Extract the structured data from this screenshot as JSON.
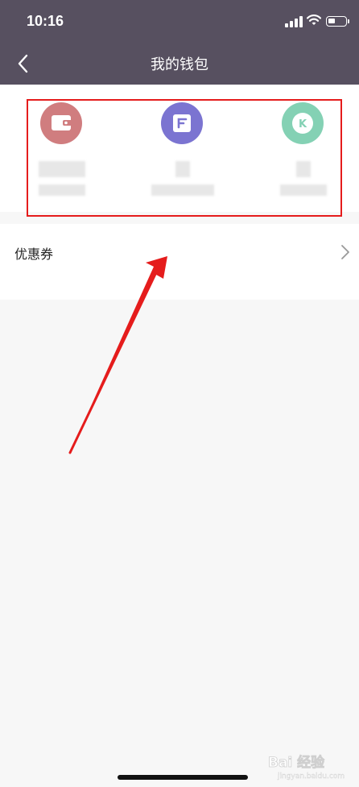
{
  "status_bar": {
    "time": "10:16",
    "battery_level": 0.4
  },
  "nav": {
    "title": "我的钱包",
    "back_icon": "chevron-left-icon"
  },
  "wallet": {
    "items": [
      {
        "icon": "wallet-icon",
        "color": "#d07d7f"
      },
      {
        "icon": "card-icon",
        "color": "#7b74d1"
      },
      {
        "icon": "k-coin-icon",
        "color": "#84d1b4",
        "glyph": "K"
      }
    ]
  },
  "coupon": {
    "label": "优惠券",
    "icon": "chevron-right-icon"
  },
  "annotations": {
    "box_color": "#e51c1c",
    "arrow_color": "#e51c1c"
  },
  "watermark": {
    "logo_text": "Bai 经验",
    "sub_text": "jingyan.baidu.com"
  },
  "colors": {
    "header_bg": "#575060",
    "page_bg": "#f7f7f7"
  }
}
